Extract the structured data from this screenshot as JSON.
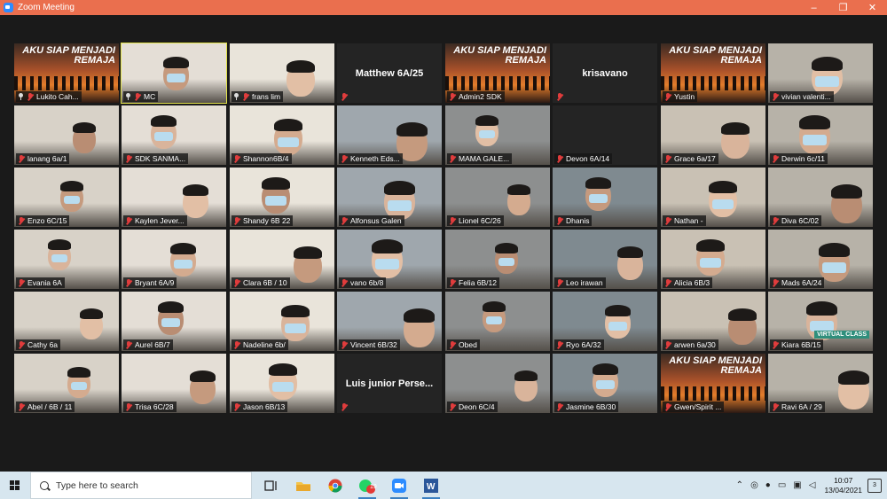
{
  "window": {
    "title": "Zoom Meeting",
    "minimize": "–",
    "maximize": "❐",
    "close": "✕"
  },
  "participants": [
    {
      "name": "Lukito Cah...",
      "kind": "poster",
      "pinned": true
    },
    {
      "name": "MC",
      "kind": "person",
      "pinned": true,
      "active": true
    },
    {
      "name": "frans lim",
      "kind": "person",
      "pinned": true
    },
    {
      "name": "Matthew 6A/25",
      "kind": "name"
    },
    {
      "name": "Admin2 SDK",
      "kind": "poster"
    },
    {
      "name": "krisavano",
      "kind": "name"
    },
    {
      "name": "Yustin",
      "kind": "poster"
    },
    {
      "name": "vivian valenti...",
      "kind": "person"
    },
    {
      "name": "lanang 6a/1",
      "kind": "person"
    },
    {
      "name": "SDK SANMA...",
      "kind": "person"
    },
    {
      "name": "Shannon6B/4",
      "kind": "person"
    },
    {
      "name": "Kenneth Eds...",
      "kind": "person"
    },
    {
      "name": "MAMA GALE...",
      "kind": "person"
    },
    {
      "name": "Devon 6A/14",
      "kind": "empty"
    },
    {
      "name": "Grace 6a/17",
      "kind": "person"
    },
    {
      "name": "Derwin 6c/11",
      "kind": "person"
    },
    {
      "name": "Enzo 6C/15",
      "kind": "person"
    },
    {
      "name": "Kaylen Jever...",
      "kind": "person"
    },
    {
      "name": "Shandy 6B 22",
      "kind": "person"
    },
    {
      "name": "Alfonsus Galen",
      "kind": "person"
    },
    {
      "name": "Lionel 6C/26",
      "kind": "person"
    },
    {
      "name": "Dhanis",
      "kind": "person"
    },
    {
      "name": "Nathan -",
      "kind": "person"
    },
    {
      "name": "Diva 6C/02",
      "kind": "person"
    },
    {
      "name": "Evania 6A",
      "kind": "person"
    },
    {
      "name": "Bryant 6A/9",
      "kind": "person"
    },
    {
      "name": "Clara 6B / 10",
      "kind": "person"
    },
    {
      "name": "vano 6b/8",
      "kind": "person"
    },
    {
      "name": "Felia 6B/12",
      "kind": "person"
    },
    {
      "name": "Leo irawan",
      "kind": "person"
    },
    {
      "name": "Alicia 6B/3",
      "kind": "person"
    },
    {
      "name": "Mads 6A/24",
      "kind": "person"
    },
    {
      "name": "Cathy 6a",
      "kind": "person"
    },
    {
      "name": "Aurel 6B/7",
      "kind": "person"
    },
    {
      "name": "Nadeline 6b/",
      "kind": "person"
    },
    {
      "name": "Vincent 6B/32",
      "kind": "person"
    },
    {
      "name": "Obed",
      "kind": "person"
    },
    {
      "name": "Ryo 6A/32",
      "kind": "person"
    },
    {
      "name": "arwen 6a/30",
      "kind": "person"
    },
    {
      "name": "Kiara 6B/15",
      "kind": "person"
    },
    {
      "name": "Abel / 6B / 11",
      "kind": "person"
    },
    {
      "name": "Trisa 6C/28",
      "kind": "person"
    },
    {
      "name": "Jason 6B/13",
      "kind": "person"
    },
    {
      "name": "Luis junior Perse...",
      "kind": "name"
    },
    {
      "name": "Deon 6C/4",
      "kind": "person"
    },
    {
      "name": "Jasmine 6B/30",
      "kind": "person"
    },
    {
      "name": "Gwen/Spirit ...",
      "kind": "poster"
    },
    {
      "name": "Ravi 6A / 29",
      "kind": "person"
    }
  ],
  "poster_text": "AKU SIAP MENJADI REMAJA",
  "virtual_class_text": "VIRTUAL CLASS",
  "taskbar": {
    "search_placeholder": "Type here to search",
    "whatsapp_badge": "19",
    "time": "10:07",
    "date": "13/04/2021",
    "notification_count": "3"
  },
  "colors": {
    "titlebar": "#ea6f4e",
    "active_speaker": "#e2e24a",
    "muted": "#e03c3c",
    "taskbar": "#d7e6ef"
  }
}
